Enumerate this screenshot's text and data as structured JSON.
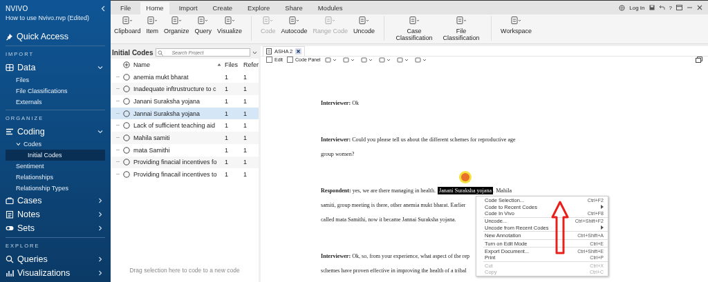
{
  "sidebar": {
    "logo": "NVIVO",
    "project": "How to use Nvivo.nvp (Edited)",
    "quick_access": "Quick Access",
    "sections": [
      {
        "heading": "IMPORT",
        "groups": [
          {
            "label": "Data",
            "expanded": true,
            "children": [
              {
                "label": "Files",
                "selected": false
              },
              {
                "label": "File Classifications",
                "selected": false
              },
              {
                "label": "Externals",
                "selected": false
              }
            ]
          }
        ]
      },
      {
        "heading": "ORGANIZE",
        "groups": [
          {
            "label": "Coding",
            "expanded": true,
            "children": [
              {
                "label": "Codes",
                "selected": false,
                "expanded": true,
                "children": [
                  {
                    "label": "Initial Codes",
                    "selected": true
                  }
                ]
              },
              {
                "label": "Sentiment",
                "selected": false
              },
              {
                "label": "Relationships",
                "selected": false
              },
              {
                "label": "Relationship Types",
                "selected": false
              }
            ]
          },
          {
            "label": "Cases",
            "expanded": false
          },
          {
            "label": "Notes",
            "expanded": false
          },
          {
            "label": "Sets",
            "expanded": false
          }
        ]
      },
      {
        "heading": "EXPLORE",
        "groups": [
          {
            "label": "Queries",
            "expanded": false
          },
          {
            "label": "Visualizations",
            "expanded": false
          }
        ]
      }
    ]
  },
  "menu_tabs": [
    {
      "label": "File",
      "selected": false
    },
    {
      "label": "Home",
      "selected": true
    },
    {
      "label": "Import",
      "selected": false
    },
    {
      "label": "Create",
      "selected": false
    },
    {
      "label": "Explore",
      "selected": false
    },
    {
      "label": "Share",
      "selected": false
    },
    {
      "label": "Modules",
      "selected": false
    }
  ],
  "account": {
    "login": "Log In",
    "help": "?"
  },
  "ribbon": [
    {
      "label": "Clipboard",
      "disabled": false
    },
    {
      "label": "Item",
      "disabled": false
    },
    {
      "label": "Organize",
      "disabled": false
    },
    {
      "label": "Query",
      "disabled": false
    },
    {
      "label": "Visualize",
      "disabled": false
    },
    {
      "label": "Code",
      "disabled": true
    },
    {
      "label": "Autocode",
      "disabled": false
    },
    {
      "label": "Range Code",
      "disabled": true
    },
    {
      "label": "Uncode",
      "disabled": false
    },
    {
      "label": "Case Classification",
      "disabled": false
    },
    {
      "label": "File Classification",
      "disabled": false
    },
    {
      "label": "Workspace",
      "disabled": false
    }
  ],
  "codes_panel": {
    "title": "Initial Codes",
    "search": {
      "placeholder": "Search Project"
    },
    "columns": [
      "Name",
      "Files",
      "Refer"
    ],
    "rows": [
      {
        "name": "anemia mukt bharat",
        "files": "1",
        "refs": "1",
        "selected": false
      },
      {
        "name": "Inadequate inftrustructure to c",
        "files": "1",
        "refs": "1",
        "selected": false
      },
      {
        "name": "Janani Suraksha yojana",
        "files": "1",
        "refs": "1",
        "selected": false
      },
      {
        "name": "Jannai Suraksha yojana",
        "files": "1",
        "refs": "1",
        "selected": true
      },
      {
        "name": "Lack of sufficient  teaching aid",
        "files": "1",
        "refs": "1",
        "selected": false
      },
      {
        "name": "Mahila samiti",
        "files": "1",
        "refs": "1",
        "selected": false
      },
      {
        "name": "mata Samithi",
        "files": "1",
        "refs": "1",
        "selected": false
      },
      {
        "name": "Providing  finacial incentives fo",
        "files": "1",
        "refs": "1",
        "selected": false
      },
      {
        "name": "Providing finacail incentives to",
        "files": "1",
        "refs": "1",
        "selected": false
      }
    ],
    "footer": "Drag selection here to code to a new code"
  },
  "document": {
    "tab": "ASHA 2",
    "toolbar": [
      {
        "label": "Edit",
        "checked": false
      },
      {
        "label": "Code Panel",
        "checked": false
      }
    ],
    "paragraphs": [
      {
        "lines": [
          [
            {
              "text": "**Interviewer:** Ok",
              "selected": false
            }
          ]
        ]
      },
      {
        "lines": [
          [
            {
              "text": "**Interviewer:** Could you please tell us about the different schemes for reproductive age",
              "selected": false
            }
          ],
          [
            {
              "text": "group women?",
              "selected": false
            }
          ]
        ]
      },
      {
        "lines": [
          [
            {
              "text": "**Respondent:** yes, we are there managing in health.",
              "selected": false
            },
            {
              "text": "Janani Suraksha yojana",
              "selected": true
            },
            {
              "text": ". Mahila",
              "selected": false
            }
          ],
          [
            {
              "text": "samiti, group meeting is there, other anemia mukt bharat. Earlier",
              "selected": false
            }
          ],
          [
            {
              "text": "called mata Samithi, now it became Jannai Suraksha yojana.",
              "selected": false
            }
          ]
        ]
      },
      {
        "lines": [
          [
            {
              "text": "**Interviewer:** Ok, so, from your experience, what aspect of the rep",
              "selected": false
            }
          ],
          [
            {
              "text": "schemes have proven effective in improving the health of a tribal",
              "selected": false
            }
          ]
        ]
      }
    ]
  },
  "context_menu": [
    {
      "kind": "item",
      "label": "Code Selection...",
      "shortcut": "Ctrl+F2",
      "disabled": false
    },
    {
      "kind": "submenu",
      "label": "Code to Recent Codes",
      "disabled": false
    },
    {
      "kind": "item",
      "label": "Code In Vivo",
      "shortcut": "Ctrl+F8",
      "disabled": false
    },
    {
      "kind": "separator"
    },
    {
      "kind": "item",
      "label": "Uncode...",
      "shortcut": "Ctrl+Shift+F2",
      "disabled": false
    },
    {
      "kind": "submenu",
      "label": "Uncode from Recent Codes",
      "disabled": false
    },
    {
      "kind": "separator"
    },
    {
      "kind": "item",
      "label": "New Annotation",
      "shortcut": "Ctrl+Shift+A",
      "disabled": false
    },
    {
      "kind": "separator"
    },
    {
      "kind": "item",
      "label": "Turn on Edit Mode",
      "shortcut": "Ctrl+E",
      "disabled": false
    },
    {
      "kind": "separator"
    },
    {
      "kind": "item",
      "label": "Export Document...",
      "shortcut": "Ctrl+Shift+E",
      "disabled": false
    },
    {
      "kind": "item",
      "label": "Print",
      "shortcut": "Ctrl+P",
      "disabled": false
    },
    {
      "kind": "separator"
    },
    {
      "kind": "item",
      "label": "Cut",
      "shortcut": "Ctrl+X",
      "disabled": true
    },
    {
      "kind": "item",
      "label": "Copy",
      "shortcut": "Ctrl+C",
      "disabled": true
    }
  ]
}
